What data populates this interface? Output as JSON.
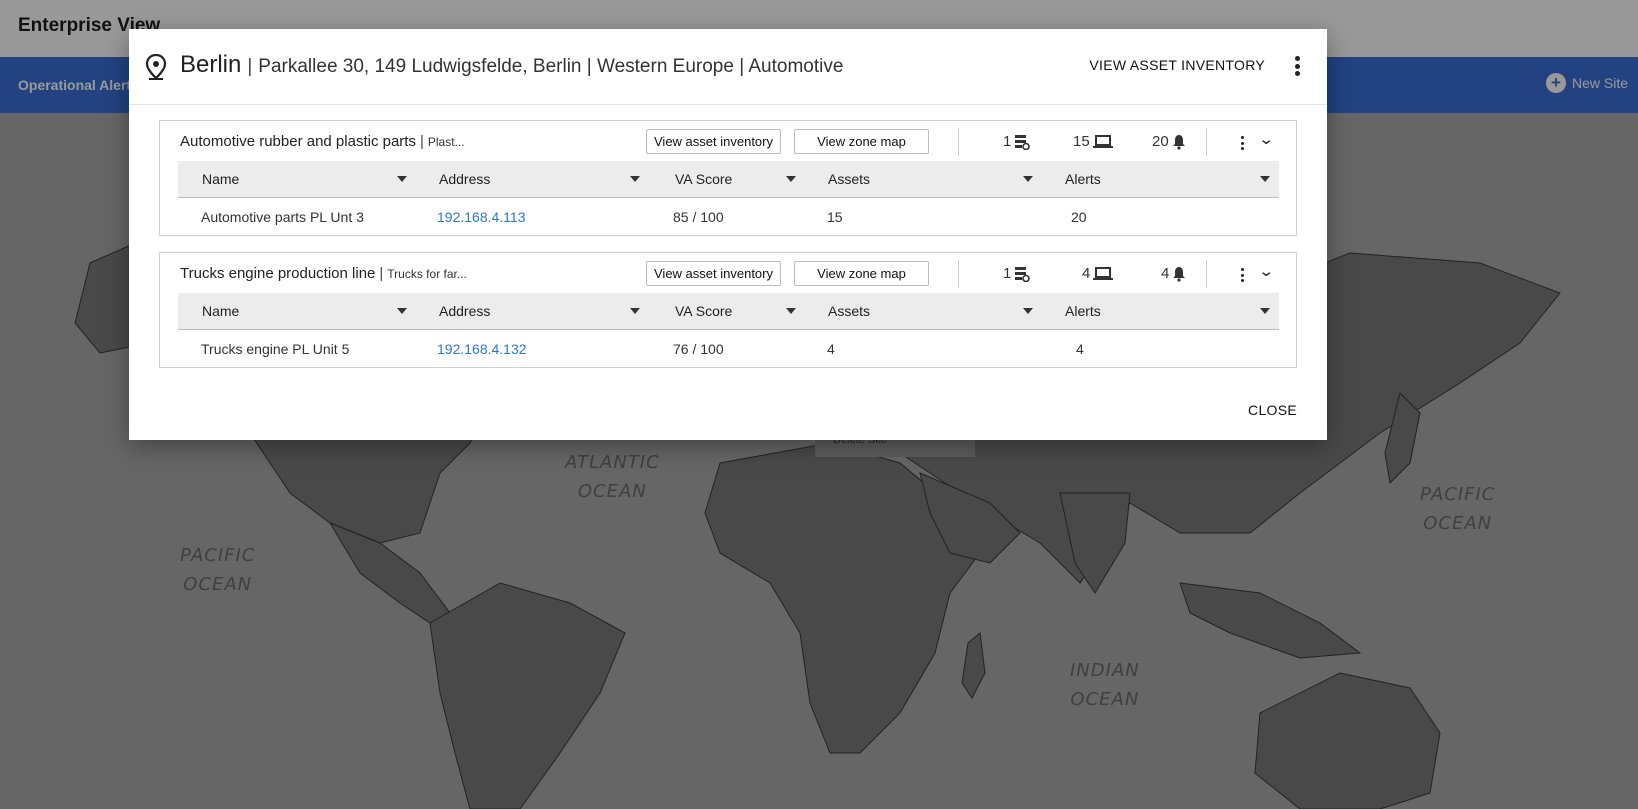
{
  "app": {
    "title": "Enterprise View",
    "nav_item": "Operational Alerts",
    "new_site_label": "New Site"
  },
  "map": {
    "oceans": [
      {
        "line1": "ATLANTIC",
        "line2": "OCEAN"
      },
      {
        "line1": "PACIFIC",
        "line2": "OCEAN"
      },
      {
        "line1": "PACIFIC",
        "line2": "OCEAN"
      },
      {
        "line1": "INDIAN",
        "line2": "OCEAN"
      }
    ],
    "context_menu_item": "Delete Site"
  },
  "dialog": {
    "site_name": "Berlin",
    "separator": "|",
    "site_details": "Parkallee 30, 149 Ludwigsfelde, Berlin | Western Europe | Automotive",
    "view_inventory_label": "VIEW ASSET INVENTORY",
    "close_label": "CLOSE",
    "columns": [
      "Name",
      "Address",
      "VA Score",
      "Assets",
      "Alerts"
    ],
    "zones": [
      {
        "name": "Automotive rubber and plastic parts",
        "description": "Plast...",
        "btn_inventory": "View asset inventory",
        "btn_zone_map": "View zone map",
        "servers": "1",
        "devices": "15",
        "alerts": "20",
        "row": {
          "name": "Automotive parts PL Unt 3",
          "address": "192.168.4.113",
          "va_score": "85 / 100",
          "assets": "15",
          "alerts": "20"
        }
      },
      {
        "name": "Trucks engine production line",
        "description": "Trucks for far...",
        "btn_inventory": "View asset inventory",
        "btn_zone_map": "View zone map",
        "servers": "1",
        "devices": "4",
        "alerts": "4",
        "row": {
          "name": "Trucks engine PL Unit 5",
          "address": "192.168.4.132",
          "va_score": "76 / 100",
          "assets": "4",
          "alerts": "4"
        }
      }
    ]
  },
  "colors": {
    "nav_blue": "#3a6fd8",
    "link_blue": "#2a78c8",
    "overlay": "rgba(0,0,0,0.40)"
  }
}
